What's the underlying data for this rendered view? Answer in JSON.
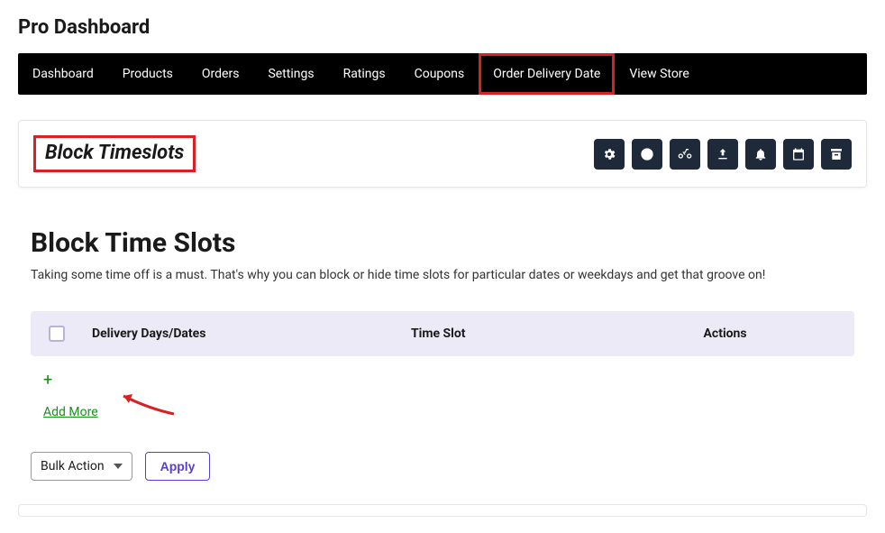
{
  "page_title": "Pro Dashboard",
  "nav": {
    "items": [
      {
        "label": "Dashboard"
      },
      {
        "label": "Products"
      },
      {
        "label": "Orders"
      },
      {
        "label": "Settings"
      },
      {
        "label": "Ratings"
      },
      {
        "label": "Coupons"
      },
      {
        "label": "Order Delivery Date"
      },
      {
        "label": "View Store"
      }
    ]
  },
  "panel": {
    "title": "Block Timeslots",
    "icons": [
      {
        "name": "gear-icon"
      },
      {
        "name": "clock-icon"
      },
      {
        "name": "bicycle-icon"
      },
      {
        "name": "upload-icon"
      },
      {
        "name": "bell-icon"
      },
      {
        "name": "calendar-icon"
      },
      {
        "name": "archive-icon"
      }
    ]
  },
  "section": {
    "heading": "Block Time Slots",
    "description": "Taking some time off is a must. That's why you can block or hide time slots for particular dates or weekdays and get that groove on!"
  },
  "table": {
    "columns": {
      "days": "Delivery Days/Dates",
      "slot": "Time Slot",
      "actions": "Actions"
    }
  },
  "add_more": {
    "plus": "+",
    "label": "Add More"
  },
  "bulk": {
    "dropdown_label": "Bulk Action",
    "apply_label": "Apply"
  }
}
